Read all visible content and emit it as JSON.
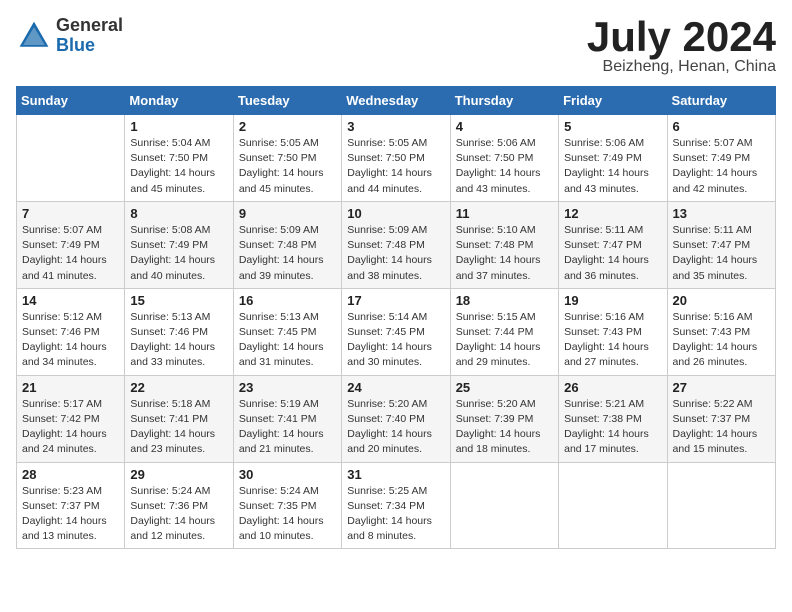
{
  "header": {
    "logo_general": "General",
    "logo_blue": "Blue",
    "month_title": "July 2024",
    "location": "Beizheng, Henan, China"
  },
  "weekdays": [
    "Sunday",
    "Monday",
    "Tuesday",
    "Wednesday",
    "Thursday",
    "Friday",
    "Saturday"
  ],
  "weeks": [
    [
      {
        "day": "",
        "sunrise": "",
        "sunset": "",
        "daylight": ""
      },
      {
        "day": "1",
        "sunrise": "Sunrise: 5:04 AM",
        "sunset": "Sunset: 7:50 PM",
        "daylight": "Daylight: 14 hours and 45 minutes."
      },
      {
        "day": "2",
        "sunrise": "Sunrise: 5:05 AM",
        "sunset": "Sunset: 7:50 PM",
        "daylight": "Daylight: 14 hours and 45 minutes."
      },
      {
        "day": "3",
        "sunrise": "Sunrise: 5:05 AM",
        "sunset": "Sunset: 7:50 PM",
        "daylight": "Daylight: 14 hours and 44 minutes."
      },
      {
        "day": "4",
        "sunrise": "Sunrise: 5:06 AM",
        "sunset": "Sunset: 7:50 PM",
        "daylight": "Daylight: 14 hours and 43 minutes."
      },
      {
        "day": "5",
        "sunrise": "Sunrise: 5:06 AM",
        "sunset": "Sunset: 7:49 PM",
        "daylight": "Daylight: 14 hours and 43 minutes."
      },
      {
        "day": "6",
        "sunrise": "Sunrise: 5:07 AM",
        "sunset": "Sunset: 7:49 PM",
        "daylight": "Daylight: 14 hours and 42 minutes."
      }
    ],
    [
      {
        "day": "7",
        "sunrise": "Sunrise: 5:07 AM",
        "sunset": "Sunset: 7:49 PM",
        "daylight": "Daylight: 14 hours and 41 minutes."
      },
      {
        "day": "8",
        "sunrise": "Sunrise: 5:08 AM",
        "sunset": "Sunset: 7:49 PM",
        "daylight": "Daylight: 14 hours and 40 minutes."
      },
      {
        "day": "9",
        "sunrise": "Sunrise: 5:09 AM",
        "sunset": "Sunset: 7:48 PM",
        "daylight": "Daylight: 14 hours and 39 minutes."
      },
      {
        "day": "10",
        "sunrise": "Sunrise: 5:09 AM",
        "sunset": "Sunset: 7:48 PM",
        "daylight": "Daylight: 14 hours and 38 minutes."
      },
      {
        "day": "11",
        "sunrise": "Sunrise: 5:10 AM",
        "sunset": "Sunset: 7:48 PM",
        "daylight": "Daylight: 14 hours and 37 minutes."
      },
      {
        "day": "12",
        "sunrise": "Sunrise: 5:11 AM",
        "sunset": "Sunset: 7:47 PM",
        "daylight": "Daylight: 14 hours and 36 minutes."
      },
      {
        "day": "13",
        "sunrise": "Sunrise: 5:11 AM",
        "sunset": "Sunset: 7:47 PM",
        "daylight": "Daylight: 14 hours and 35 minutes."
      }
    ],
    [
      {
        "day": "14",
        "sunrise": "Sunrise: 5:12 AM",
        "sunset": "Sunset: 7:46 PM",
        "daylight": "Daylight: 14 hours and 34 minutes."
      },
      {
        "day": "15",
        "sunrise": "Sunrise: 5:13 AM",
        "sunset": "Sunset: 7:46 PM",
        "daylight": "Daylight: 14 hours and 33 minutes."
      },
      {
        "day": "16",
        "sunrise": "Sunrise: 5:13 AM",
        "sunset": "Sunset: 7:45 PM",
        "daylight": "Daylight: 14 hours and 31 minutes."
      },
      {
        "day": "17",
        "sunrise": "Sunrise: 5:14 AM",
        "sunset": "Sunset: 7:45 PM",
        "daylight": "Daylight: 14 hours and 30 minutes."
      },
      {
        "day": "18",
        "sunrise": "Sunrise: 5:15 AM",
        "sunset": "Sunset: 7:44 PM",
        "daylight": "Daylight: 14 hours and 29 minutes."
      },
      {
        "day": "19",
        "sunrise": "Sunrise: 5:16 AM",
        "sunset": "Sunset: 7:43 PM",
        "daylight": "Daylight: 14 hours and 27 minutes."
      },
      {
        "day": "20",
        "sunrise": "Sunrise: 5:16 AM",
        "sunset": "Sunset: 7:43 PM",
        "daylight": "Daylight: 14 hours and 26 minutes."
      }
    ],
    [
      {
        "day": "21",
        "sunrise": "Sunrise: 5:17 AM",
        "sunset": "Sunset: 7:42 PM",
        "daylight": "Daylight: 14 hours and 24 minutes."
      },
      {
        "day": "22",
        "sunrise": "Sunrise: 5:18 AM",
        "sunset": "Sunset: 7:41 PM",
        "daylight": "Daylight: 14 hours and 23 minutes."
      },
      {
        "day": "23",
        "sunrise": "Sunrise: 5:19 AM",
        "sunset": "Sunset: 7:41 PM",
        "daylight": "Daylight: 14 hours and 21 minutes."
      },
      {
        "day": "24",
        "sunrise": "Sunrise: 5:20 AM",
        "sunset": "Sunset: 7:40 PM",
        "daylight": "Daylight: 14 hours and 20 minutes."
      },
      {
        "day": "25",
        "sunrise": "Sunrise: 5:20 AM",
        "sunset": "Sunset: 7:39 PM",
        "daylight": "Daylight: 14 hours and 18 minutes."
      },
      {
        "day": "26",
        "sunrise": "Sunrise: 5:21 AM",
        "sunset": "Sunset: 7:38 PM",
        "daylight": "Daylight: 14 hours and 17 minutes."
      },
      {
        "day": "27",
        "sunrise": "Sunrise: 5:22 AM",
        "sunset": "Sunset: 7:37 PM",
        "daylight": "Daylight: 14 hours and 15 minutes."
      }
    ],
    [
      {
        "day": "28",
        "sunrise": "Sunrise: 5:23 AM",
        "sunset": "Sunset: 7:37 PM",
        "daylight": "Daylight: 14 hours and 13 minutes."
      },
      {
        "day": "29",
        "sunrise": "Sunrise: 5:24 AM",
        "sunset": "Sunset: 7:36 PM",
        "daylight": "Daylight: 14 hours and 12 minutes."
      },
      {
        "day": "30",
        "sunrise": "Sunrise: 5:24 AM",
        "sunset": "Sunset: 7:35 PM",
        "daylight": "Daylight: 14 hours and 10 minutes."
      },
      {
        "day": "31",
        "sunrise": "Sunrise: 5:25 AM",
        "sunset": "Sunset: 7:34 PM",
        "daylight": "Daylight: 14 hours and 8 minutes."
      },
      {
        "day": "",
        "sunrise": "",
        "sunset": "",
        "daylight": ""
      },
      {
        "day": "",
        "sunrise": "",
        "sunset": "",
        "daylight": ""
      },
      {
        "day": "",
        "sunrise": "",
        "sunset": "",
        "daylight": ""
      }
    ]
  ]
}
